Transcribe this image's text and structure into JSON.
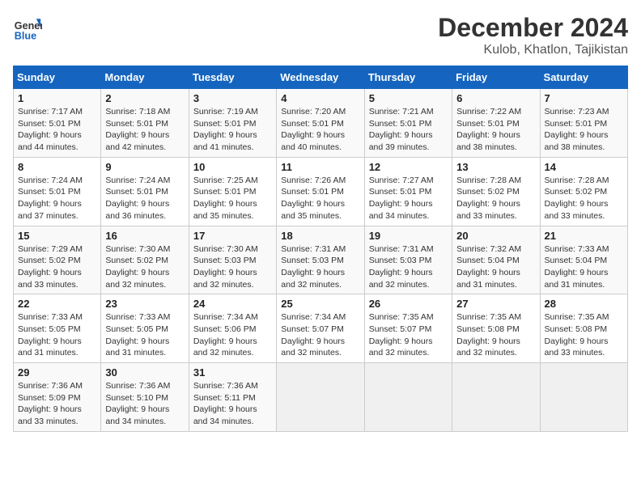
{
  "header": {
    "logo_general": "General",
    "logo_blue": "Blue",
    "month": "December 2024",
    "location": "Kulob, Khatlon, Tajikistan"
  },
  "weekdays": [
    "Sunday",
    "Monday",
    "Tuesday",
    "Wednesday",
    "Thursday",
    "Friday",
    "Saturday"
  ],
  "weeks": [
    [
      {
        "day": "1",
        "sunrise": "7:17 AM",
        "sunset": "5:01 PM",
        "daylight": "9 hours and 44 minutes."
      },
      {
        "day": "2",
        "sunrise": "7:18 AM",
        "sunset": "5:01 PM",
        "daylight": "9 hours and 42 minutes."
      },
      {
        "day": "3",
        "sunrise": "7:19 AM",
        "sunset": "5:01 PM",
        "daylight": "9 hours and 41 minutes."
      },
      {
        "day": "4",
        "sunrise": "7:20 AM",
        "sunset": "5:01 PM",
        "daylight": "9 hours and 40 minutes."
      },
      {
        "day": "5",
        "sunrise": "7:21 AM",
        "sunset": "5:01 PM",
        "daylight": "9 hours and 39 minutes."
      },
      {
        "day": "6",
        "sunrise": "7:22 AM",
        "sunset": "5:01 PM",
        "daylight": "9 hours and 38 minutes."
      },
      {
        "day": "7",
        "sunrise": "7:23 AM",
        "sunset": "5:01 PM",
        "daylight": "9 hours and 38 minutes."
      }
    ],
    [
      {
        "day": "8",
        "sunrise": "7:24 AM",
        "sunset": "5:01 PM",
        "daylight": "9 hours and 37 minutes."
      },
      {
        "day": "9",
        "sunrise": "7:24 AM",
        "sunset": "5:01 PM",
        "daylight": "9 hours and 36 minutes."
      },
      {
        "day": "10",
        "sunrise": "7:25 AM",
        "sunset": "5:01 PM",
        "daylight": "9 hours and 35 minutes."
      },
      {
        "day": "11",
        "sunrise": "7:26 AM",
        "sunset": "5:01 PM",
        "daylight": "9 hours and 35 minutes."
      },
      {
        "day": "12",
        "sunrise": "7:27 AM",
        "sunset": "5:01 PM",
        "daylight": "9 hours and 34 minutes."
      },
      {
        "day": "13",
        "sunrise": "7:28 AM",
        "sunset": "5:02 PM",
        "daylight": "9 hours and 33 minutes."
      },
      {
        "day": "14",
        "sunrise": "7:28 AM",
        "sunset": "5:02 PM",
        "daylight": "9 hours and 33 minutes."
      }
    ],
    [
      {
        "day": "15",
        "sunrise": "7:29 AM",
        "sunset": "5:02 PM",
        "daylight": "9 hours and 33 minutes."
      },
      {
        "day": "16",
        "sunrise": "7:30 AM",
        "sunset": "5:02 PM",
        "daylight": "9 hours and 32 minutes."
      },
      {
        "day": "17",
        "sunrise": "7:30 AM",
        "sunset": "5:03 PM",
        "daylight": "9 hours and 32 minutes."
      },
      {
        "day": "18",
        "sunrise": "7:31 AM",
        "sunset": "5:03 PM",
        "daylight": "9 hours and 32 minutes."
      },
      {
        "day": "19",
        "sunrise": "7:31 AM",
        "sunset": "5:03 PM",
        "daylight": "9 hours and 32 minutes."
      },
      {
        "day": "20",
        "sunrise": "7:32 AM",
        "sunset": "5:04 PM",
        "daylight": "9 hours and 31 minutes."
      },
      {
        "day": "21",
        "sunrise": "7:33 AM",
        "sunset": "5:04 PM",
        "daylight": "9 hours and 31 minutes."
      }
    ],
    [
      {
        "day": "22",
        "sunrise": "7:33 AM",
        "sunset": "5:05 PM",
        "daylight": "9 hours and 31 minutes."
      },
      {
        "day": "23",
        "sunrise": "7:33 AM",
        "sunset": "5:05 PM",
        "daylight": "9 hours and 31 minutes."
      },
      {
        "day": "24",
        "sunrise": "7:34 AM",
        "sunset": "5:06 PM",
        "daylight": "9 hours and 32 minutes."
      },
      {
        "day": "25",
        "sunrise": "7:34 AM",
        "sunset": "5:07 PM",
        "daylight": "9 hours and 32 minutes."
      },
      {
        "day": "26",
        "sunrise": "7:35 AM",
        "sunset": "5:07 PM",
        "daylight": "9 hours and 32 minutes."
      },
      {
        "day": "27",
        "sunrise": "7:35 AM",
        "sunset": "5:08 PM",
        "daylight": "9 hours and 32 minutes."
      },
      {
        "day": "28",
        "sunrise": "7:35 AM",
        "sunset": "5:08 PM",
        "daylight": "9 hours and 33 minutes."
      }
    ],
    [
      {
        "day": "29",
        "sunrise": "7:36 AM",
        "sunset": "5:09 PM",
        "daylight": "9 hours and 33 minutes."
      },
      {
        "day": "30",
        "sunrise": "7:36 AM",
        "sunset": "5:10 PM",
        "daylight": "9 hours and 34 minutes."
      },
      {
        "day": "31",
        "sunrise": "7:36 AM",
        "sunset": "5:11 PM",
        "daylight": "9 hours and 34 minutes."
      },
      null,
      null,
      null,
      null
    ]
  ]
}
